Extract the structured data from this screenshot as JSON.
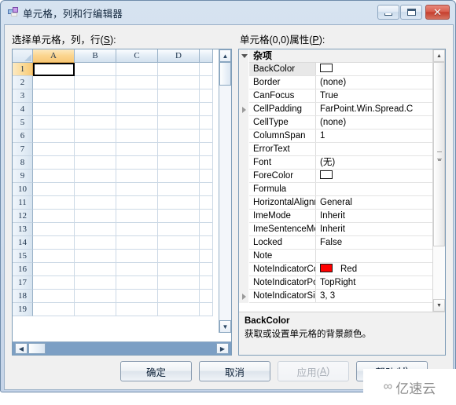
{
  "window": {
    "title": "单元格，列和行编辑器",
    "icon": "vs-editor-icon",
    "buttons": {
      "minimize": "minimize-icon",
      "maximize": "maximize-icon",
      "close": "✕"
    }
  },
  "labels": {
    "left_prefix": "选择单元格，列，行(",
    "left_mnemonic": "S",
    "left_suffix": "):",
    "right_prefix": "单元格(0,0)属性(",
    "right_mnemonic": "P",
    "right_suffix": "):"
  },
  "grid": {
    "columns": [
      "A",
      "B",
      "C",
      "D"
    ],
    "rows": [
      "1",
      "2",
      "3",
      "4",
      "5",
      "6",
      "7",
      "8",
      "9",
      "10",
      "11",
      "12",
      "13",
      "14",
      "15",
      "16",
      "17",
      "18",
      "19"
    ],
    "selected_column": "A",
    "selected_row": "1",
    "active_cell": "A1",
    "active_cell_value": "",
    "scroll_up_icon": "▲",
    "scroll_down_icon": "▼",
    "scroll_left_icon": "◀",
    "scroll_right_icon": "▶"
  },
  "properties": {
    "category": "杂项",
    "selected": "BackColor",
    "rows": [
      {
        "name": "BackColor",
        "value": "",
        "swatch": "#ffffff",
        "swatch_label": "",
        "expandable": false,
        "selected": true
      },
      {
        "name": "Border",
        "value": "(none)",
        "expandable": false,
        "selected": false
      },
      {
        "name": "CanFocus",
        "value": "True",
        "expandable": false,
        "selected": false
      },
      {
        "name": "CellPadding",
        "value": "FarPoint.Win.Spread.C",
        "expandable": true,
        "selected": false
      },
      {
        "name": "CellType",
        "value": "(none)",
        "expandable": false,
        "selected": false
      },
      {
        "name": "ColumnSpan",
        "value": "1",
        "expandable": false,
        "selected": false
      },
      {
        "name": "ErrorText",
        "value": "",
        "expandable": false,
        "selected": false
      },
      {
        "name": "Font",
        "value": "(无)",
        "expandable": false,
        "selected": false
      },
      {
        "name": "ForeColor",
        "value": "",
        "swatch": "#ffffff",
        "swatch_label": "",
        "expandable": false,
        "selected": false
      },
      {
        "name": "Formula",
        "value": "",
        "expandable": false,
        "selected": false
      },
      {
        "name": "HorizontalAlignme",
        "value": "General",
        "expandable": false,
        "selected": false
      },
      {
        "name": "ImeMode",
        "value": "Inherit",
        "expandable": false,
        "selected": false
      },
      {
        "name": "ImeSentenceMode",
        "value": "Inherit",
        "expandable": false,
        "selected": false
      },
      {
        "name": "Locked",
        "value": "False",
        "expandable": false,
        "selected": false
      },
      {
        "name": "Note",
        "value": "",
        "expandable": false,
        "selected": false
      },
      {
        "name": "NoteIndicatorColo",
        "value": "",
        "swatch": "#ff0000",
        "swatch_label": "Red",
        "expandable": false,
        "selected": false
      },
      {
        "name": "NoteIndicatorPosi",
        "value": "TopRight",
        "expandable": false,
        "selected": false
      },
      {
        "name": "NoteIndicatorSize",
        "value": "3, 3",
        "expandable": true,
        "selected": false
      }
    ],
    "scroll_up_icon": "▲",
    "scroll_down_icon": "▼"
  },
  "description": {
    "title": "BackColor",
    "body": "获取或设置单元格的背景颜色。"
  },
  "dialog_buttons": {
    "ok": "确定",
    "cancel": "取消",
    "apply_prefix": "应用(",
    "apply_mnemonic": "A",
    "apply_suffix": ")",
    "help_prefix": "帮助(",
    "help_mnemonic": "H",
    "help_suffix": ")"
  },
  "watermark": {
    "text": "亿速云",
    "mark": "∞"
  },
  "colors": {
    "selection_orange": "#f8c877",
    "note_indicator_red": "#ff0000",
    "close_button_red": "#c63f2e",
    "window_border": "#6f8cab"
  }
}
